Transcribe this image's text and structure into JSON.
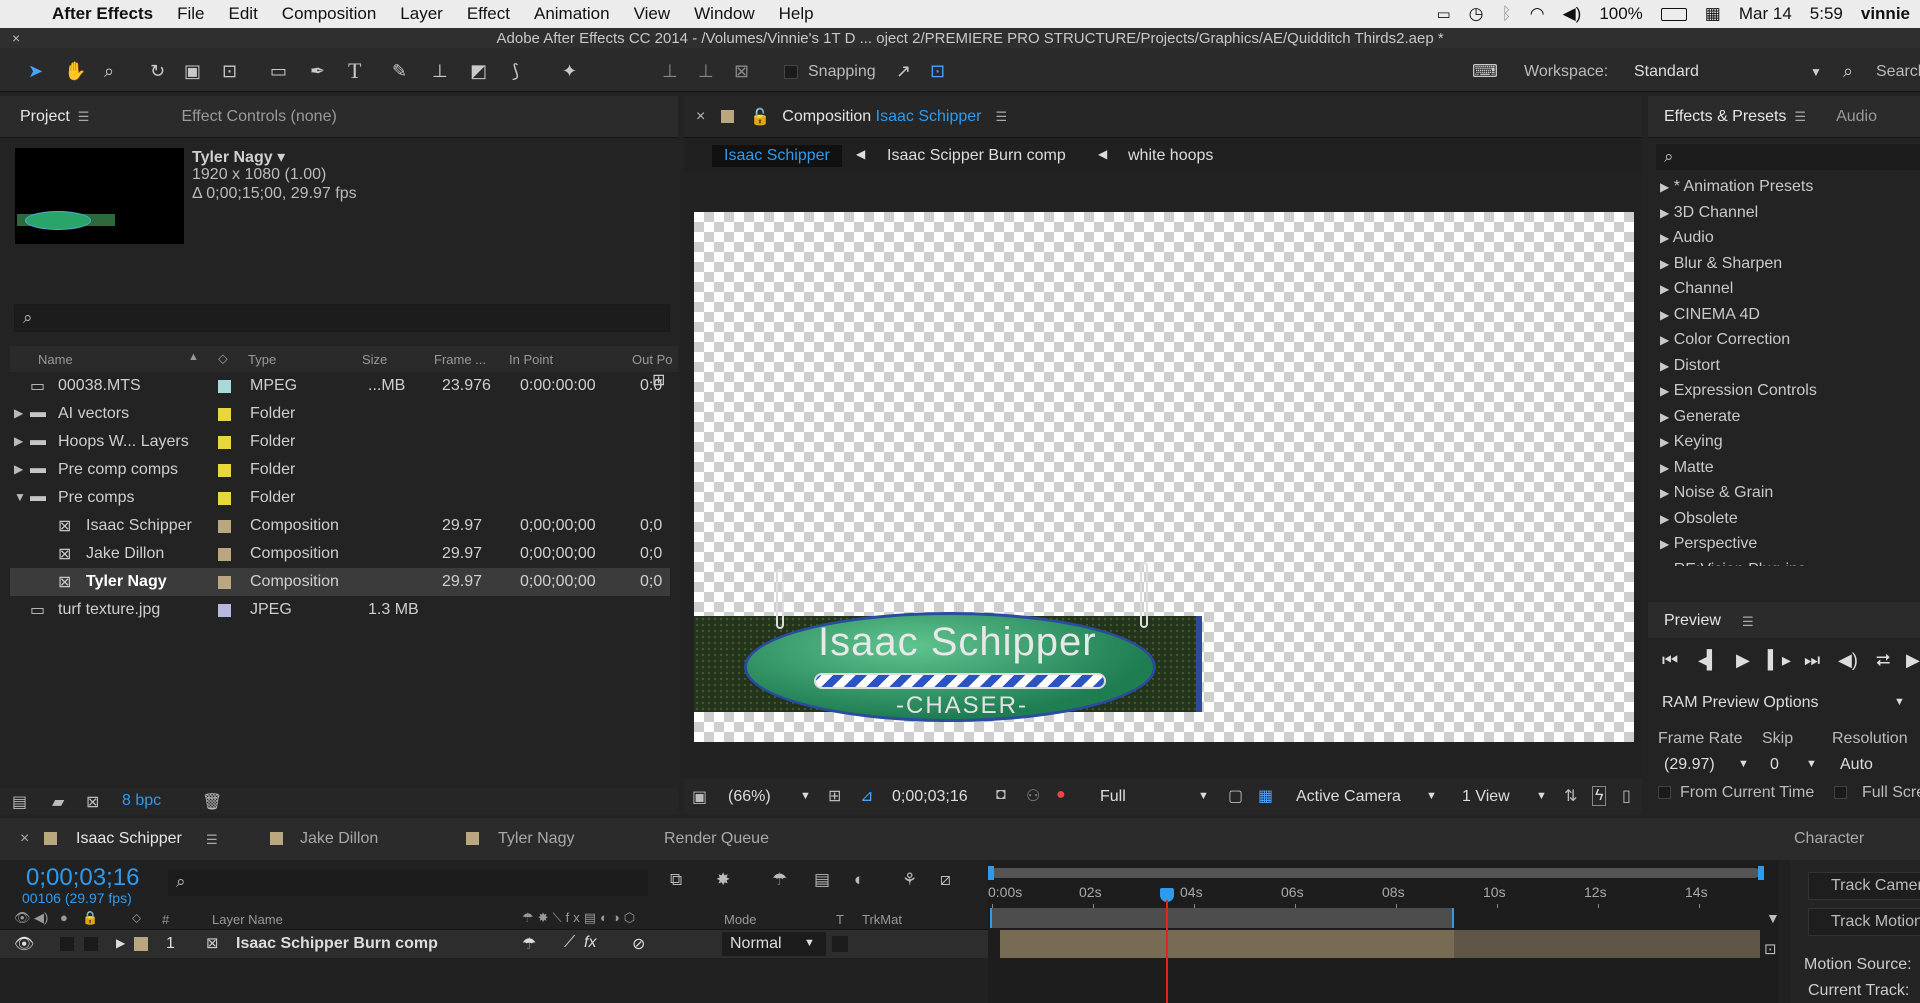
{
  "menubar": {
    "app_name": "After Effects",
    "items": [
      "File",
      "Edit",
      "Composition",
      "Layer",
      "Effect",
      "Animation",
      "View",
      "Window",
      "Help"
    ],
    "battery": "100%",
    "date": "Mar 14",
    "time": "5:59",
    "user": "vinnie"
  },
  "window_title": "Adobe After Effects CC 2014 - /Volumes/Vinnie's 1T D ... oject 2/PREMIERE PRO STRUCTURE/Projects/Graphics/AE/Quidditch Thirds2.aep *",
  "toolbar": {
    "snapping_label": "Snapping",
    "workspace_label": "Workspace:",
    "workspace_value": "Standard",
    "search_label": "Search"
  },
  "project_panel": {
    "tab_project": "Project",
    "tab_effect_controls": "Effect Controls (none)",
    "selected_name": "Tyler Nagy ▾",
    "selected_dims": "1920 x 1080 (1.00)",
    "selected_duration": "Δ 0;00;15;00, 29.97 fps",
    "columns": {
      "name": "Name",
      "type": "Type",
      "size": "Size",
      "frame": "Frame ...",
      "in": "In Point",
      "out": "Out Po"
    },
    "rows": [
      {
        "name": "00038.MTS",
        "type": "MPEG",
        "size": "...MB",
        "frame": "23.976",
        "in": "0:00:00:00",
        "out": "0:0",
        "color": "#a9d8d8",
        "kind": "file",
        "indent": 0,
        "arrow": ""
      },
      {
        "name": "AI vectors",
        "type": "Folder",
        "size": "",
        "frame": "",
        "in": "",
        "out": "",
        "color": "#e9d53c",
        "kind": "folder",
        "indent": 0,
        "arrow": "▶"
      },
      {
        "name": "Hoops W... Layers",
        "type": "Folder",
        "size": "",
        "frame": "",
        "in": "",
        "out": "",
        "color": "#e9d53c",
        "kind": "folder",
        "indent": 0,
        "arrow": "▶"
      },
      {
        "name": "Pre comp comps",
        "type": "Folder",
        "size": "",
        "frame": "",
        "in": "",
        "out": "",
        "color": "#e9d53c",
        "kind": "folder",
        "indent": 0,
        "arrow": "▶"
      },
      {
        "name": "Pre comps",
        "type": "Folder",
        "size": "",
        "frame": "",
        "in": "",
        "out": "",
        "color": "#e9d53c",
        "kind": "folder",
        "indent": 0,
        "arrow": "▼"
      },
      {
        "name": "Isaac Schipper",
        "type": "Composition",
        "size": "",
        "frame": "29.97",
        "in": "0;00;00;00",
        "out": "0;0",
        "color": "#bba77f",
        "kind": "comp",
        "indent": 1,
        "arrow": ""
      },
      {
        "name": "Jake Dillon",
        "type": "Composition",
        "size": "",
        "frame": "29.97",
        "in": "0;00;00;00",
        "out": "0;0",
        "color": "#bba77f",
        "kind": "comp",
        "indent": 1,
        "arrow": ""
      },
      {
        "name": "Tyler Nagy",
        "type": "Composition",
        "size": "",
        "frame": "29.97",
        "in": "0;00;00;00",
        "out": "0;0",
        "color": "#bba77f",
        "kind": "comp",
        "indent": 1,
        "arrow": "",
        "selected": true
      },
      {
        "name": "turf texture.jpg",
        "type": "JPEG",
        "size": "1.3 MB",
        "frame": "",
        "in": "",
        "out": "",
        "color": "#b7b7e0",
        "kind": "file",
        "indent": 0,
        "arrow": ""
      }
    ],
    "bpc": "8 bpc"
  },
  "comp_panel": {
    "tab_prefix": "Composition",
    "tab_comp": "Isaac Schipper",
    "breadcrumbs": [
      "Isaac Schipper",
      "Isaac Scipper Burn comp",
      "white hoops"
    ],
    "lower_third_name": "Isaac Schipper",
    "lower_third_role": "-CHASER-",
    "zoom": "(66%)",
    "timecode": "0;00;03;16",
    "resolution": "Full",
    "camera": "Active Camera",
    "view": "1 View"
  },
  "effects_panel": {
    "tab_effects": "Effects & Presets",
    "tab_audio": "Audio",
    "items": [
      "* Animation Presets",
      "3D Channel",
      "Audio",
      "Blur & Sharpen",
      "Channel",
      "CINEMA 4D",
      "Color Correction",
      "Distort",
      "Expression Controls",
      "Generate",
      "Keying",
      "Matte",
      "Noise & Grain",
      "Obsolete",
      "Perspective",
      "RE:Vision Plug-ins"
    ]
  },
  "preview_panel": {
    "title": "Preview",
    "ram_options": "RAM Preview Options",
    "frame_rate_label": "Frame Rate",
    "skip_label": "Skip",
    "resolution_label": "Resolution",
    "frame_rate_value": "(29.97)",
    "skip_value": "0",
    "resolution_value": "Auto",
    "from_current": "From Current Time",
    "full_screen": "Full Scre"
  },
  "timeline": {
    "tabs": [
      "Isaac Schipper",
      "Jake Dillon",
      "Tyler Nagy",
      "Render Queue"
    ],
    "timecode": "0;00;03;16",
    "frame_info": "00106 (29.97 fps)",
    "col_hash": "#",
    "col_layer_name": "Layer Name",
    "col_mode": "Mode",
    "col_t": "T",
    "col_trkmat": "TrkMat",
    "ruler": [
      "0:00s",
      "02s",
      "04s",
      "06s",
      "08s",
      "10s",
      "12s",
      "14s"
    ],
    "layer_number": "1",
    "layer_name": "Isaac Schipper Burn comp",
    "layer_mode": "Normal",
    "tracker_tab": "Character",
    "tracker_items": [
      "Track Camera",
      "Track Motion",
      "Motion Source:",
      "Current Track:"
    ]
  },
  "colors": {
    "accent": "#2d9bf0",
    "playhead": "#e02424",
    "label_tan": "#bba77f"
  }
}
